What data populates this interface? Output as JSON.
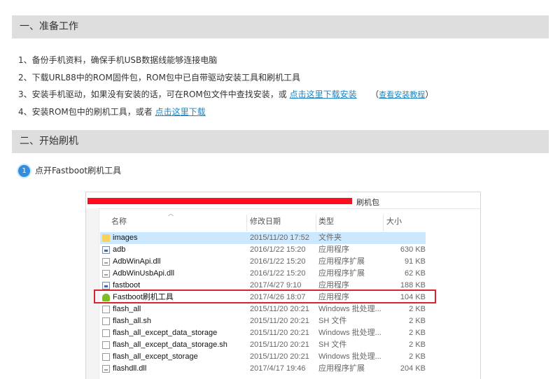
{
  "section1": {
    "title": "一、准备工作"
  },
  "steps": {
    "s1": "1、备份手机资料，确保手机USB数据线能够连接电脑",
    "s2": "2、下载URL88中的ROM固件包，ROM包中已自带驱动安装工具和刷机工具",
    "s3_text": "3、安装手机驱动，如果没有安装的话，可在ROM包文件中查找安装，或",
    "s3_link": "点击这里下载安装",
    "s3_paren_open": "（",
    "s3_small_link": "查看安装教程",
    "s3_paren_close": "）",
    "s4_text": "4、安装ROM包中的刷机工具，或者",
    "s4_link": "点击这里下载"
  },
  "section2": {
    "title": "二、开始刷机"
  },
  "substep": {
    "badge": "1",
    "text": "点开Fastboot刷机工具"
  },
  "explorer": {
    "path_tail": "刷机包",
    "columns": {
      "name": "名称",
      "date": "修改日期",
      "type": "类型",
      "size": "大小"
    },
    "rows": [
      {
        "name": "images",
        "date": "2015/11/20 17:52",
        "type": "文件夹",
        "size": "",
        "icon": "folder-icon"
      },
      {
        "name": "adb",
        "date": "2016/1/22 15:20",
        "type": "应用程序",
        "size": "630 KB",
        "icon": "exe-icon"
      },
      {
        "name": "AdbWinApi.dll",
        "date": "2016/1/22 15:20",
        "type": "应用程序扩展",
        "size": "91 KB",
        "icon": "dll-icon"
      },
      {
        "name": "AdbWinUsbApi.dll",
        "date": "2016/1/22 15:20",
        "type": "应用程序扩展",
        "size": "62 KB",
        "icon": "dll-icon"
      },
      {
        "name": "fastboot",
        "date": "2017/4/27 9:10",
        "type": "应用程序",
        "size": "188 KB",
        "icon": "exe-icon"
      },
      {
        "name": "Fastboot刷机工具",
        "date": "2017/4/26 18:07",
        "type": "应用程序",
        "size": "104 KB",
        "icon": "android-icon"
      },
      {
        "name": "flash_all",
        "date": "2015/11/20 20:21",
        "type": "Windows 批处理...",
        "size": "2 KB",
        "icon": "file-icon"
      },
      {
        "name": "flash_all.sh",
        "date": "2015/11/20 20:21",
        "type": "SH 文件",
        "size": "2 KB",
        "icon": "file-icon"
      },
      {
        "name": "flash_all_except_data_storage",
        "date": "2015/11/20 20:21",
        "type": "Windows 批处理...",
        "size": "2 KB",
        "icon": "file-icon"
      },
      {
        "name": "flash_all_except_data_storage.sh",
        "date": "2015/11/20 20:21",
        "type": "SH 文件",
        "size": "2 KB",
        "icon": "file-icon"
      },
      {
        "name": "flash_all_except_storage",
        "date": "2015/11/20 20:21",
        "type": "Windows 批处理...",
        "size": "2 KB",
        "icon": "file-icon"
      },
      {
        "name": "flashdll.dll",
        "date": "2017/4/17 19:46",
        "type": "应用程序扩展",
        "size": "204 KB",
        "icon": "dll-icon"
      }
    ]
  },
  "colors": {
    "link": "#1a86c8",
    "header_bg": "#dedede",
    "highlight": "#d8262e",
    "selection": "#cce8ff"
  }
}
